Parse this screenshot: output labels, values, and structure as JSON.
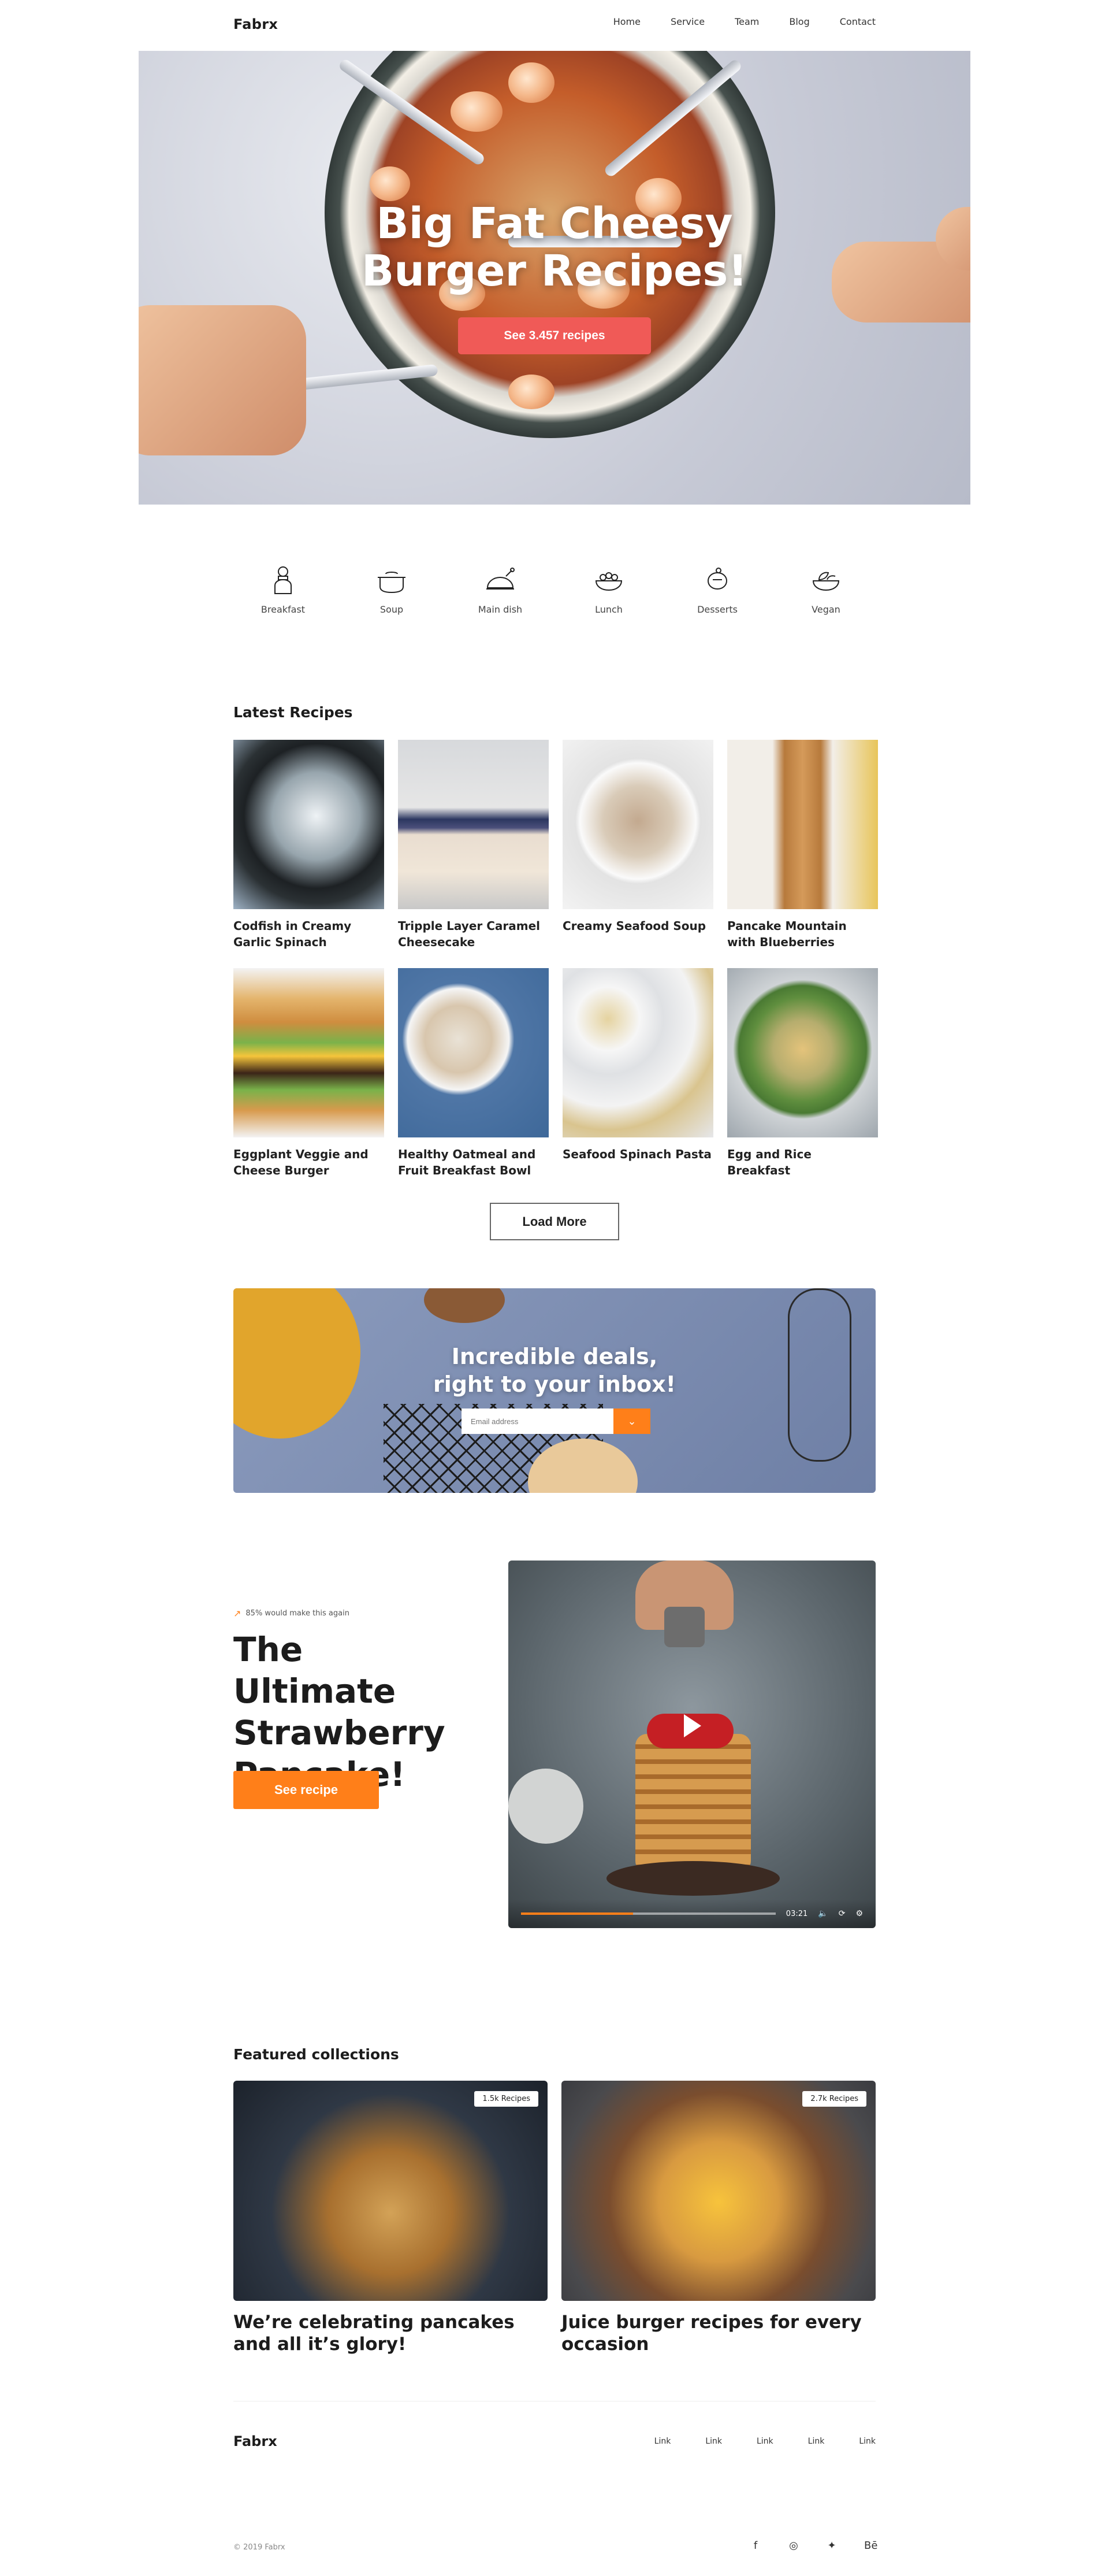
{
  "nav": {
    "logo": "Fabrx",
    "links": [
      "Home",
      "Service",
      "Team",
      "Blog",
      "Contact"
    ]
  },
  "hero": {
    "title_line1": "Big Fat Cheesy",
    "title_line2": "Burger Recipes!",
    "button": "See 3.457 recipes"
  },
  "categories": [
    {
      "label": "Breakfast",
      "icon": "chef-icon"
    },
    {
      "label": "Soup",
      "icon": "soup-pot-icon"
    },
    {
      "label": "Main dish",
      "icon": "roast-chicken-icon"
    },
    {
      "label": "Lunch",
      "icon": "lunch-bowl-icon"
    },
    {
      "label": "Desserts",
      "icon": "dessert-icon"
    },
    {
      "label": "Vegan",
      "icon": "vegan-bowl-icon"
    }
  ],
  "latest": {
    "title": "Latest Recipes",
    "items": [
      "Codfish in Creamy Garlic Spinach",
      "Tripple Layer Caramel Cheesecake",
      "Creamy Seafood Soup",
      "Pancake Mountain with Blueberries",
      "Eggplant Veggie and Cheese Burger",
      "Healthy Oatmeal and Fruit Breakfast Bowl",
      "Seafood Spinach Pasta",
      "Egg and Rice Breakfast"
    ],
    "load_more": "Load More"
  },
  "newsletter": {
    "title_line1": "Incredible deals,",
    "title_line2": "right to your inbox!",
    "placeholder": "Email address"
  },
  "featured": {
    "tag": "85% would make this again",
    "title": "The Ultimate Strawberry Pancake!",
    "button": "See recipe",
    "video_time": "03:21",
    "video_progress": 0.44
  },
  "collections": {
    "title": "Featured collections",
    "items": [
      {
        "badge": "1.5k Recipes",
        "caption": "We’re celebrating pancakes and all it’s glory!"
      },
      {
        "badge": "2.7k Recipes",
        "caption": "Juice burger recipes for every occasion"
      }
    ]
  },
  "footer": {
    "logo": "Fabrx",
    "links": [
      "Link",
      "Link",
      "Link",
      "Link",
      "Link"
    ],
    "copyright": "© 2019 Fabrx",
    "social": [
      "facebook-icon",
      "instagram-icon",
      "twitter-icon",
      "behance-icon"
    ]
  },
  "colors": {
    "accent_orange": "#ff7f19",
    "hero_button": "#f05a57"
  }
}
